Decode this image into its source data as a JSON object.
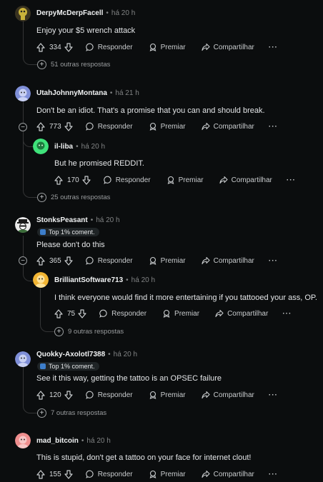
{
  "labels": {
    "reply": "Responder",
    "award": "Premiar",
    "share": "Compartilhar",
    "more": "···"
  },
  "comments": [
    {
      "author": "DerpyMcDerpFacell",
      "time": "há 20 h",
      "text": "Enjoy your $5 wrench attack",
      "score": "334",
      "more_replies": "51 outras respostas"
    },
    {
      "author": "UtahJohnnyMontana",
      "time": "há 21 h",
      "text": "Don't be an idiot. That's a promise that you can and should break.",
      "score": "773",
      "more_replies": "25 outras respostas",
      "reply": {
        "author": "il-liba",
        "time": "há 20 h",
        "text": "But he promised REDDIT.",
        "score": "170"
      }
    },
    {
      "author": "StonksPeasant",
      "time": "há 20 h",
      "badge": "Top 1% coment.",
      "text": "Please don't do this",
      "score": "365",
      "reply": {
        "author": "BrilliantSoftware713",
        "time": "há 20 h",
        "text": "I think everyone would find it more entertaining if you tattooed your ass, OP.",
        "score": "75",
        "more_replies": "9 outras respostas"
      }
    },
    {
      "author": "Quokky-Axolotl7388",
      "time": "há 20 h",
      "badge": "Top 1% coment.",
      "text": "See it this way, getting the tattoo is an OPSEC failure",
      "score": "120",
      "more_replies": "7 outras respostas"
    },
    {
      "author": "mad_bitcoin",
      "time": "há 20 h",
      "text": "This is stupid, don't get a tattoo on your face for internet clout!",
      "score": "155"
    }
  ],
  "colors": {
    "background": "#0b0d0e",
    "avatar_derpy": "#c9b23a",
    "avatar_utah": "#7f8fd8",
    "avatar_illiba": "#3fe27a",
    "avatar_stonks": "#e9e9e9",
    "avatar_brilliant": "#f2b533",
    "avatar_quokky": "#7f8fd8",
    "avatar_mad": "#ef8e8e"
  }
}
